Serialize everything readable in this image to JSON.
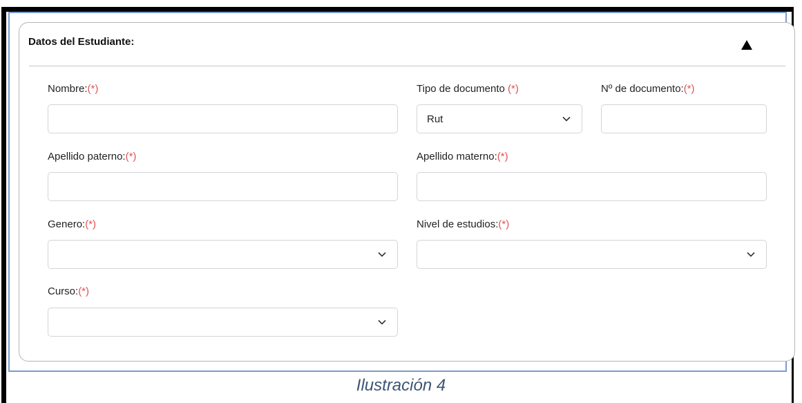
{
  "student_form": {
    "title": "Datos del Estudiante:",
    "toggle_icon": "triangle-up-icon",
    "required_marker": "(*)",
    "fields": {
      "nombre": {
        "label": "Nombre:",
        "value": ""
      },
      "tipo_documento": {
        "label": "Tipo de documento ",
        "selected": "Rut"
      },
      "numero_documento": {
        "label": "Nº de documento:",
        "value": ""
      },
      "apellido_paterno": {
        "label": "Apellido paterno:",
        "value": ""
      },
      "apellido_materno": {
        "label": "Apellido materno:",
        "value": ""
      },
      "genero": {
        "label": "Genero:",
        "selected": ""
      },
      "nivel_estudios": {
        "label": "Nivel de estudios:",
        "selected": ""
      },
      "curso": {
        "label": "Curso:",
        "selected": ""
      }
    }
  },
  "caption": "Ilustración 4",
  "colors": {
    "required": "#e25252",
    "frame_blue": "#7a9bd0",
    "caption": "#3d5473"
  }
}
